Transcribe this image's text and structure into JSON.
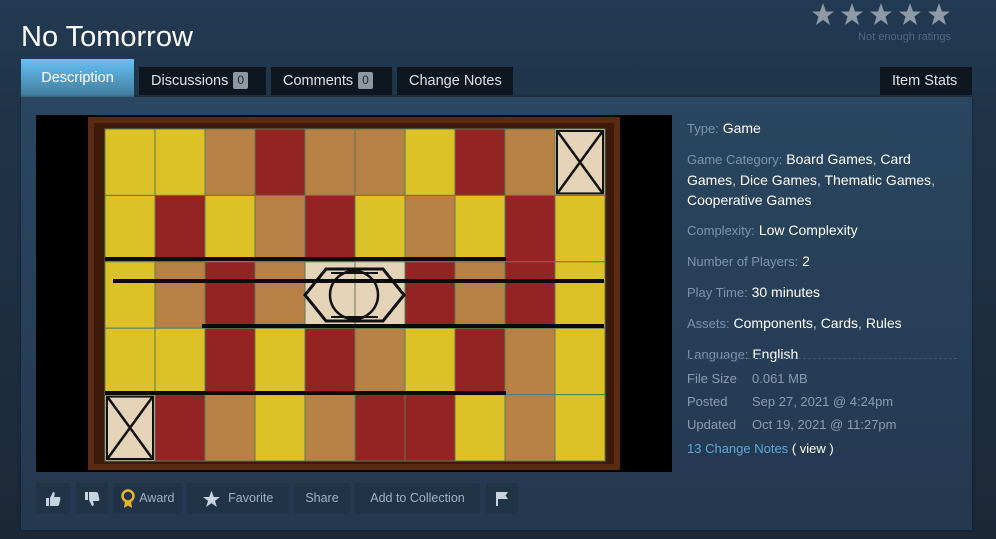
{
  "title": "No Tomorrow",
  "rating": {
    "stars": 5,
    "note": "Not enough ratings"
  },
  "tabs": [
    {
      "label": "Description",
      "active": true
    },
    {
      "label": "Discussions",
      "count": "0"
    },
    {
      "label": "Comments",
      "count": "0"
    },
    {
      "label": "Change Notes"
    },
    {
      "label": "Item Stats"
    }
  ],
  "details": {
    "type_label": "Type:",
    "type_value": "Game",
    "category_label": "Game Category:",
    "categories": [
      "Board Games",
      "Card Games",
      "Dice Games",
      "Thematic Games",
      "Cooperative Games"
    ],
    "complexity_label": "Complexity:",
    "complexity_value": "Low Complexity",
    "players_label": "Number of Players:",
    "players_value": "2",
    "playtime_label": "Play Time:",
    "playtime_value": "30 minutes",
    "assets_label": "Assets:",
    "assets": [
      "Components",
      "Cards",
      "Rules"
    ],
    "language_label": "Language:",
    "language_value": "English"
  },
  "stats": {
    "filesize_label": "File Size",
    "filesize_value": "0.061 MB",
    "posted_label": "Posted",
    "posted_value": "Sep 27, 2021 @ 4:24pm",
    "updated_label": "Updated",
    "updated_value": "Oct 19, 2021 @ 11:27pm",
    "changenotes_link": "13 Change Notes",
    "view_text": "( view )"
  },
  "actions": {
    "award": "Award",
    "favorite": "Favorite",
    "share": "Share",
    "add_collection": "Add to Collection"
  },
  "colors": {
    "background": "#1b2838",
    "accent": "#67c1f5",
    "link": "#5fa8d6",
    "board_yellow": "#dcc227",
    "board_red": "#932423",
    "board_tan": "#b78045",
    "board_frame": "#5a2a13"
  }
}
